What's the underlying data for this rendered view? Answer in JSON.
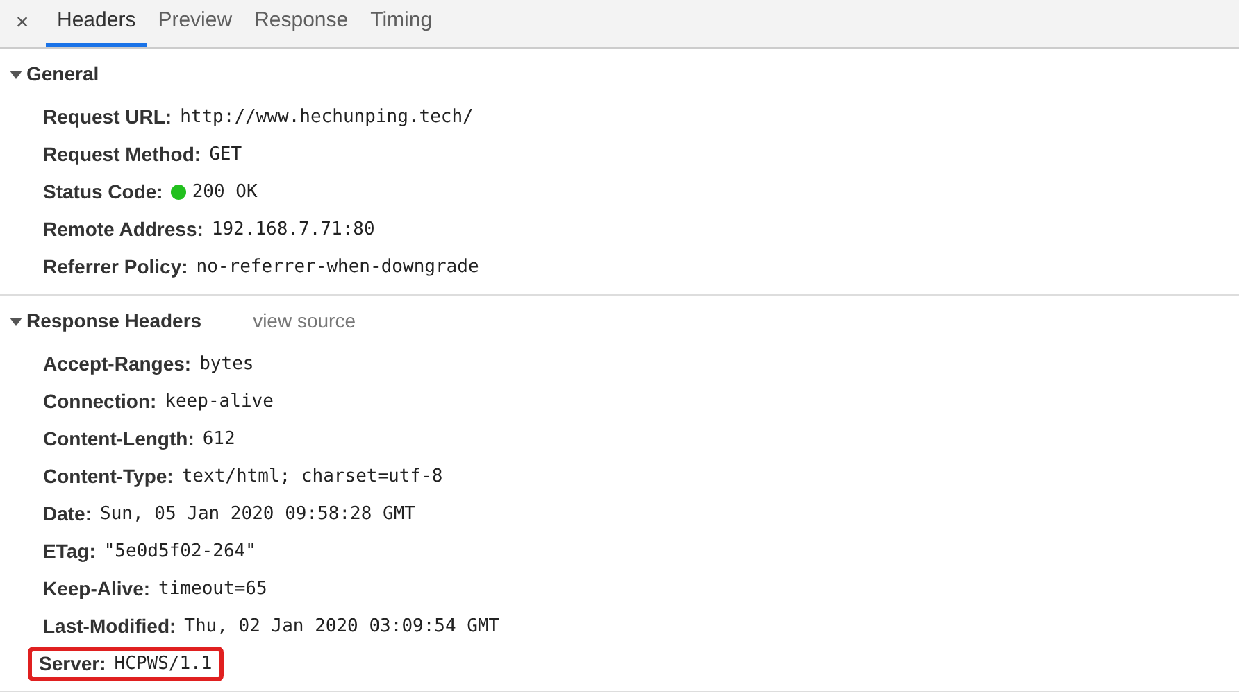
{
  "close_label": "×",
  "tabs": [
    {
      "label": "Headers",
      "selected": true
    },
    {
      "label": "Preview",
      "selected": false
    },
    {
      "label": "Response",
      "selected": false
    },
    {
      "label": "Timing",
      "selected": false
    }
  ],
  "sections": [
    {
      "title": "General",
      "expanded": true,
      "rows": [
        {
          "name": "Request URL:",
          "value": "http://www.hechunping.tech/",
          "highlighted": false
        },
        {
          "name": "Request Method:",
          "value": "GET",
          "highlighted": false
        },
        {
          "name": "Status Code:",
          "value": "200 OK",
          "color": "#22c01e",
          "highlighted": false
        },
        {
          "name": "Remote Address:",
          "value": "192.168.7.71:80",
          "highlighted": false
        },
        {
          "name": "Referrer Policy:",
          "value": "no-referrer-when-downgrade",
          "highlighted": false
        }
      ]
    },
    {
      "title": "Response Headers",
      "link": "view source",
      "expanded": true,
      "rows": [
        {
          "name": "Accept-Ranges:",
          "value": "bytes",
          "highlighted": false
        },
        {
          "name": "Connection:",
          "value": "keep-alive",
          "highlighted": false
        },
        {
          "name": "Content-Length:",
          "value": "612",
          "highlighted": false
        },
        {
          "name": "Content-Type:",
          "value": "text/html; charset=utf-8",
          "highlighted": false
        },
        {
          "name": "Date:",
          "value": "Sun, 05 Jan 2020 09:58:28 GMT",
          "highlighted": false
        },
        {
          "name": "ETag:",
          "value": "\"5e0d5f02-264\"",
          "highlighted": false
        },
        {
          "name": "Keep-Alive:",
          "value": "timeout=65",
          "highlighted": false
        },
        {
          "name": "Last-Modified:",
          "value": "Thu, 02 Jan 2020 03:09:54 GMT",
          "highlighted": false
        },
        {
          "name": "Server:",
          "value": "HCPWS/1.1",
          "highlighted": true
        }
      ]
    }
  ]
}
